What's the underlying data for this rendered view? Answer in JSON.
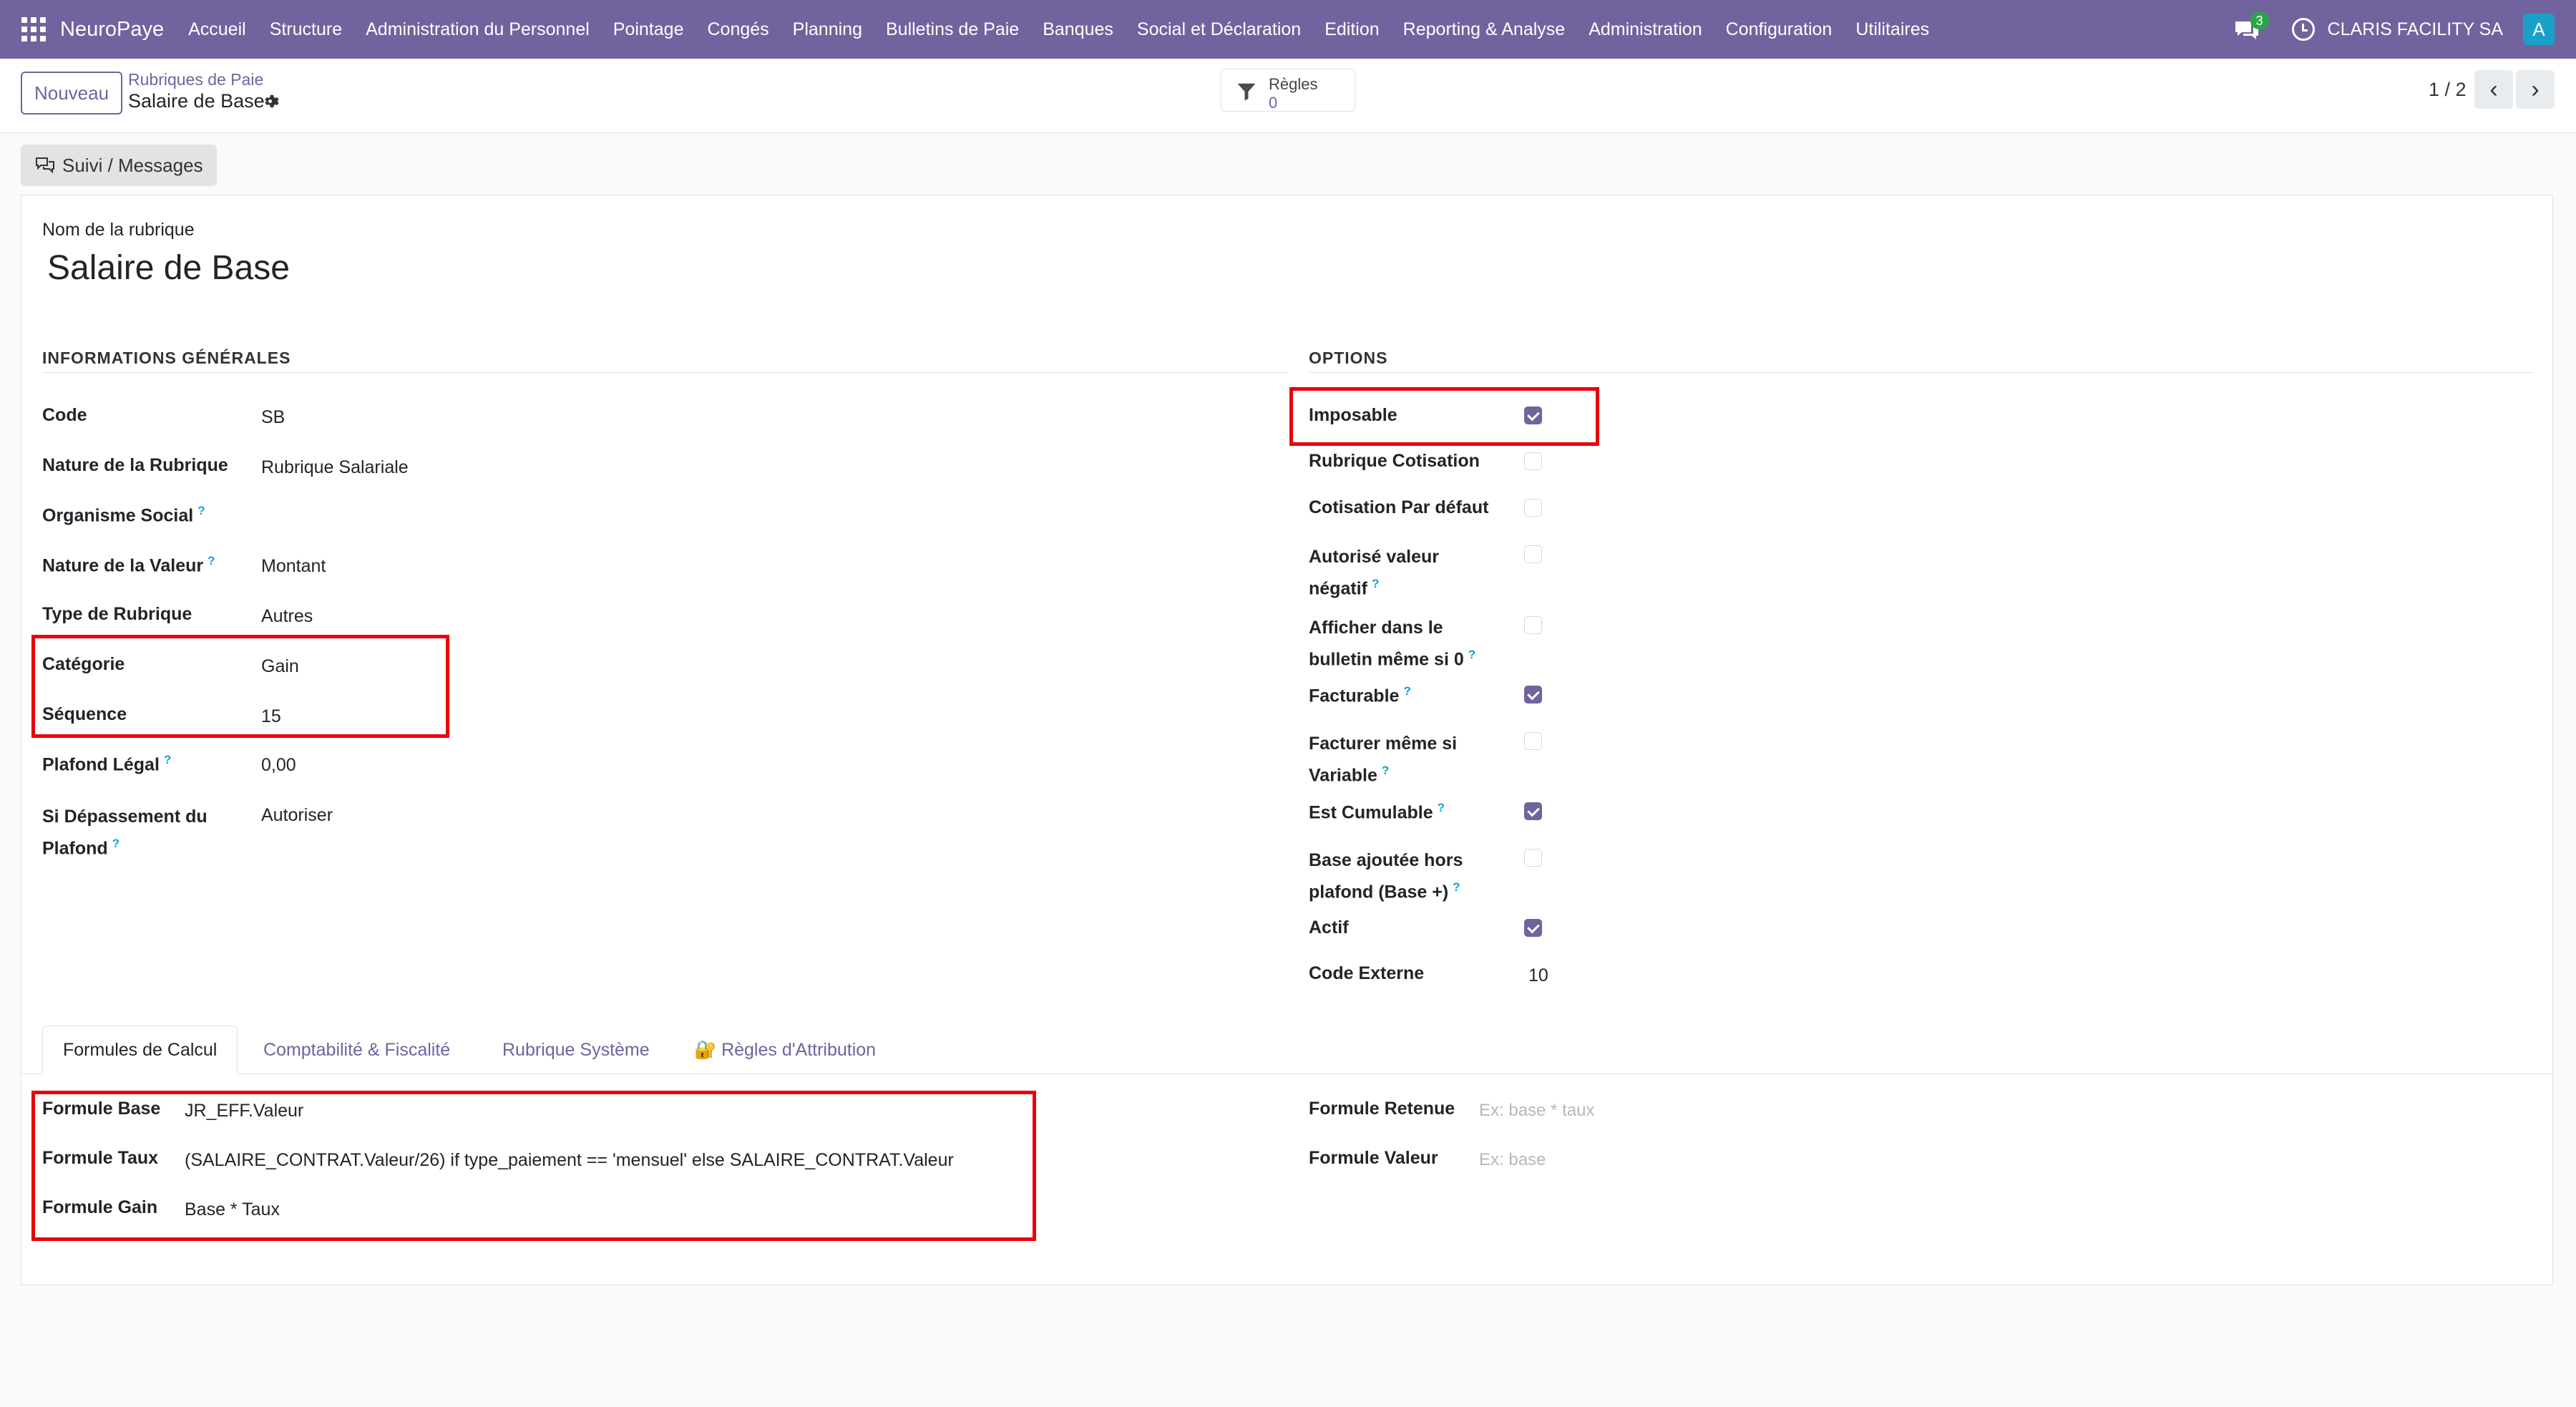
{
  "topbar": {
    "brand": "NeuroPaye",
    "menu": [
      "Accueil",
      "Structure",
      "Administration du Personnel",
      "Pointage",
      "Congés",
      "Planning",
      "Bulletins de Paie",
      "Banques",
      "Social et Déclaration",
      "Edition",
      "Reporting & Analyse",
      "Administration",
      "Configuration",
      "Utilitaires"
    ],
    "chat_count": "3",
    "company": "CLARIS FACILITY SA",
    "avatar_letter": "A"
  },
  "control": {
    "new_label": "Nouveau",
    "breadcrumb_parent": "Rubriques de Paie",
    "breadcrumb_current": "Salaire de Base",
    "rules_label": "Règles",
    "rules_count": "0",
    "pager": "1 / 2"
  },
  "chatter_button": "Suivi / Messages",
  "form": {
    "name_label": "Nom de la rubrique",
    "name_value": "Salaire de Base",
    "general": {
      "title": "INFORMATIONS GÉNÉRALES",
      "code_label": "Code",
      "code_value": "SB",
      "nature_label": "Nature de la Rubrique",
      "nature_value": "Rubrique Salariale",
      "organisme_label": "Organisme Social",
      "nature_valeur_label": "Nature de la Valeur",
      "nature_valeur_value": "Montant",
      "type_label": "Type de Rubrique",
      "type_value": "Autres",
      "categorie_label": "Catégorie",
      "categorie_value": "Gain",
      "sequence_label": "Séquence",
      "sequence_value": "15",
      "plafond_label": "Plafond Légal",
      "plafond_value": "0,00",
      "depassement_label_1": "Si Dépassement du",
      "depassement_label_2": "Plafond",
      "depassement_value": "Autoriser"
    },
    "options": {
      "title": "OPTIONS",
      "imposable": "Imposable",
      "rubrique_cotisation": "Rubrique Cotisation",
      "cotisation_defaut": "Cotisation Par défaut",
      "autorise_1": "Autorisé valeur",
      "autorise_2": "négatif",
      "afficher_1": "Afficher dans le",
      "afficher_2": "bulletin même si 0",
      "facturable": "Facturable",
      "facturer_1": "Facturer même si",
      "facturer_2": "Variable",
      "cumulable": "Est Cumulable",
      "base_1": "Base ajoutée hors",
      "base_2": "plafond (Base +)",
      "actif": "Actif",
      "code_externe_label": "Code Externe",
      "code_externe_value": "10"
    },
    "tabs": [
      "Formules de Calcul",
      "Comptabilité & Fiscalité",
      "Rubrique Système",
      "🔐 Règles d'Attribution"
    ],
    "formulas": {
      "base_label": "Formule Base",
      "base_value": "JR_EFF.Valeur",
      "taux_label": "Formule Taux",
      "taux_value": "(SALAIRE_CONTRAT.Valeur/26) if type_paiement == 'mensuel' else SALAIRE_CONTRAT.Valeur",
      "gain_label": "Formule Gain",
      "gain_value": "Base * Taux",
      "retenue_label": "Formule Retenue",
      "retenue_placeholder": "Ex: base * taux",
      "valeur_label": "Formule Valeur",
      "valeur_placeholder": "Ex: base"
    }
  },
  "colors": {
    "primary": "#71639e",
    "highlight": "#e8000b",
    "help": "#0aa3d6"
  }
}
